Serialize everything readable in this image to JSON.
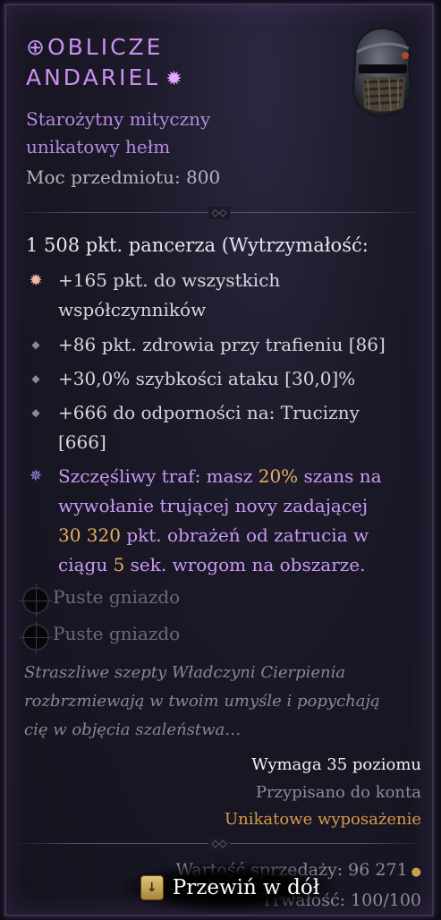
{
  "item": {
    "name_line1": "OBLICZE",
    "name_line2": "ANDARIEL",
    "title_glyph": "⊕",
    "mythic_mark": "✹",
    "type_line1": "Starożytny mityczny",
    "type_line2": "unikatowy hełm",
    "power": "Moc przedmiotu: 800",
    "armor": "1 508 pkt. pancerza (Wytrzymałość:",
    "icon": "helm-icon"
  },
  "affixes": [
    {
      "bullet": "star",
      "lines": [
        "+165 pkt. do wszystkich",
        "współczynników"
      ]
    },
    {
      "bullet": "diamond",
      "lines": [
        "+86 pkt. zdrowia przy trafieniu [86]"
      ]
    },
    {
      "bullet": "diamond",
      "lines": [
        "+30,0% szybkości ataku [30,0]%"
      ]
    },
    {
      "bullet": "diamond",
      "lines": [
        "+666 do odporności na: Trucizny",
        "[666]"
      ]
    }
  ],
  "unique_power": {
    "p1": "Szczęśliwy traf: masz ",
    "v1": "20%",
    "p2": " szans na",
    "l2": "wywołanie trującej novy zadającej",
    "v2": "30 320",
    "p3": " pkt. obrażeń od zatrucia w",
    "p4": "ciągu ",
    "v3": "5",
    "p5": " sek. wrogom na obszarze."
  },
  "sockets": [
    "Puste gniazdo",
    "Puste gniazdo"
  ],
  "flavor": [
    "Straszliwe szepty Władczyni Cierpienia",
    "rozbrzmiewają w twoim umyśle i popychają",
    "cię w objęcia szaleństwa…"
  ],
  "requirements": {
    "level": "Wymaga 35 poziomu",
    "bound": "Przypisano do konta",
    "rarity": "Unikatowe wyposażenie"
  },
  "footer": {
    "sell_label": "Wartość sprzedaży: 96 271",
    "durability": "Trwałość: 100/100",
    "scroll_key": "↓",
    "scroll_label": "Przewiń w dół"
  },
  "colors": {
    "title": "#c891f0",
    "gold": "#e4b066",
    "unique_orange": "#d99a4a",
    "lucky_hit": "#c89af5"
  }
}
